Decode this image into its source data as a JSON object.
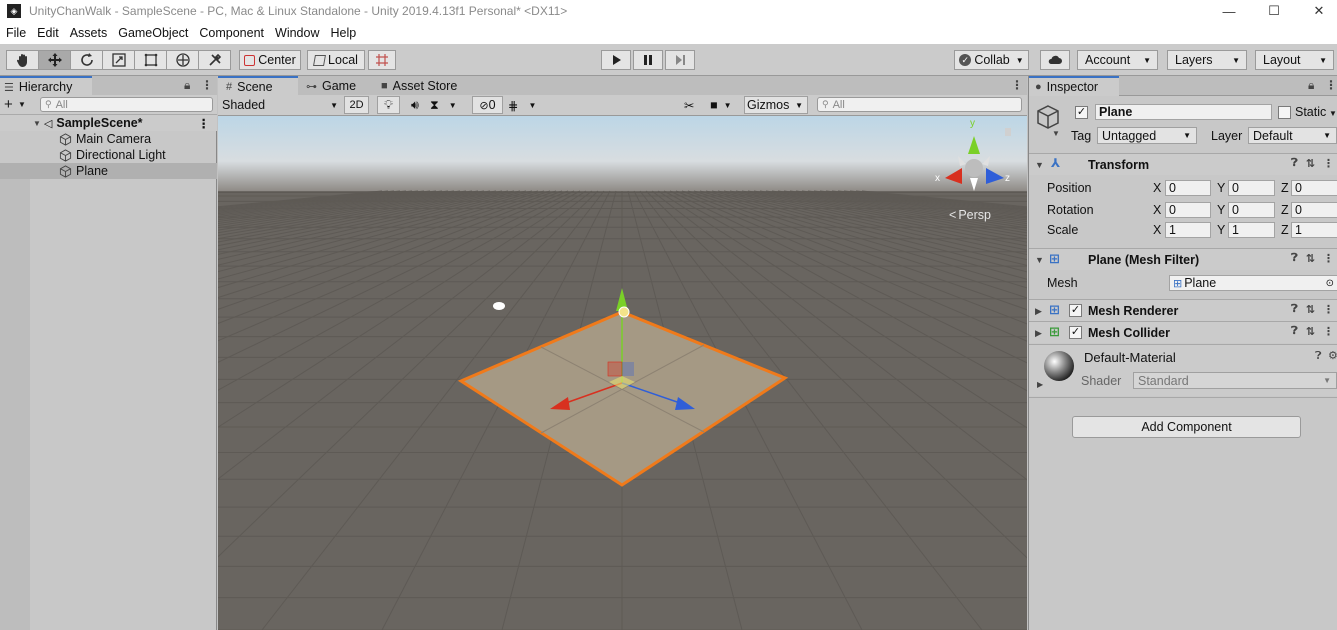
{
  "window": {
    "title": "UnityChanWalk - SampleScene - PC, Mac & Linux Standalone - Unity 2019.4.13f1 Personal* <DX11>",
    "minimize": "—",
    "maximize": "☐",
    "close": "✕"
  },
  "menu": [
    "File",
    "Edit",
    "Assets",
    "GameObject",
    "Component",
    "Window",
    "Help"
  ],
  "toolbar": {
    "pivot_label": "Center",
    "space_label": "Local",
    "collab_label": "Collab",
    "account_label": "Account",
    "layers_label": "Layers",
    "layout_label": "Layout"
  },
  "hierarchy": {
    "tab_label": "Hierarchy",
    "search_placeholder": "All",
    "scene_name": "SampleScene*",
    "items": [
      {
        "label": "Main Camera"
      },
      {
        "label": "Directional Light"
      },
      {
        "label": "Plane"
      }
    ]
  },
  "scene_view": {
    "tabs": [
      {
        "label": "Scene"
      },
      {
        "label": "Game"
      },
      {
        "label": "Asset Store"
      }
    ],
    "draw_mode": "Shaded",
    "mode_2d": "2D",
    "hidden_count": "0",
    "gizmos_label": "Gizmos",
    "search_placeholder": "All",
    "persp_label": "Persp",
    "axis_x": "x",
    "axis_y": "y",
    "axis_z": "z"
  },
  "inspector": {
    "tab_label": "Inspector",
    "object_name": "Plane",
    "static_label": "Static",
    "tag_label": "Tag",
    "tag_value": "Untagged",
    "layer_label": "Layer",
    "layer_value": "Default",
    "transform": {
      "title": "Transform",
      "position_label": "Position",
      "rotation_label": "Rotation",
      "scale_label": "Scale",
      "position": {
        "x": "0",
        "y": "0",
        "z": "0"
      },
      "rotation": {
        "x": "0",
        "y": "0",
        "z": "0"
      },
      "scale": {
        "x": "1",
        "y": "1",
        "z": "1"
      }
    },
    "mesh_filter": {
      "title": "Plane (Mesh Filter)",
      "mesh_label": "Mesh",
      "mesh_value": "Plane"
    },
    "mesh_renderer": {
      "title": "Mesh Renderer"
    },
    "mesh_collider": {
      "title": "Mesh Collider"
    },
    "material": {
      "name": "Default-Material",
      "shader_label": "Shader",
      "shader_value": "Standard"
    },
    "add_component_label": "Add Component"
  },
  "colors": {
    "selection_outline": "#f07a1a",
    "axis_x": "#d8301f",
    "axis_y": "#7ad028",
    "axis_z": "#2f5ed8",
    "tab_accent": "#3a72c4"
  }
}
